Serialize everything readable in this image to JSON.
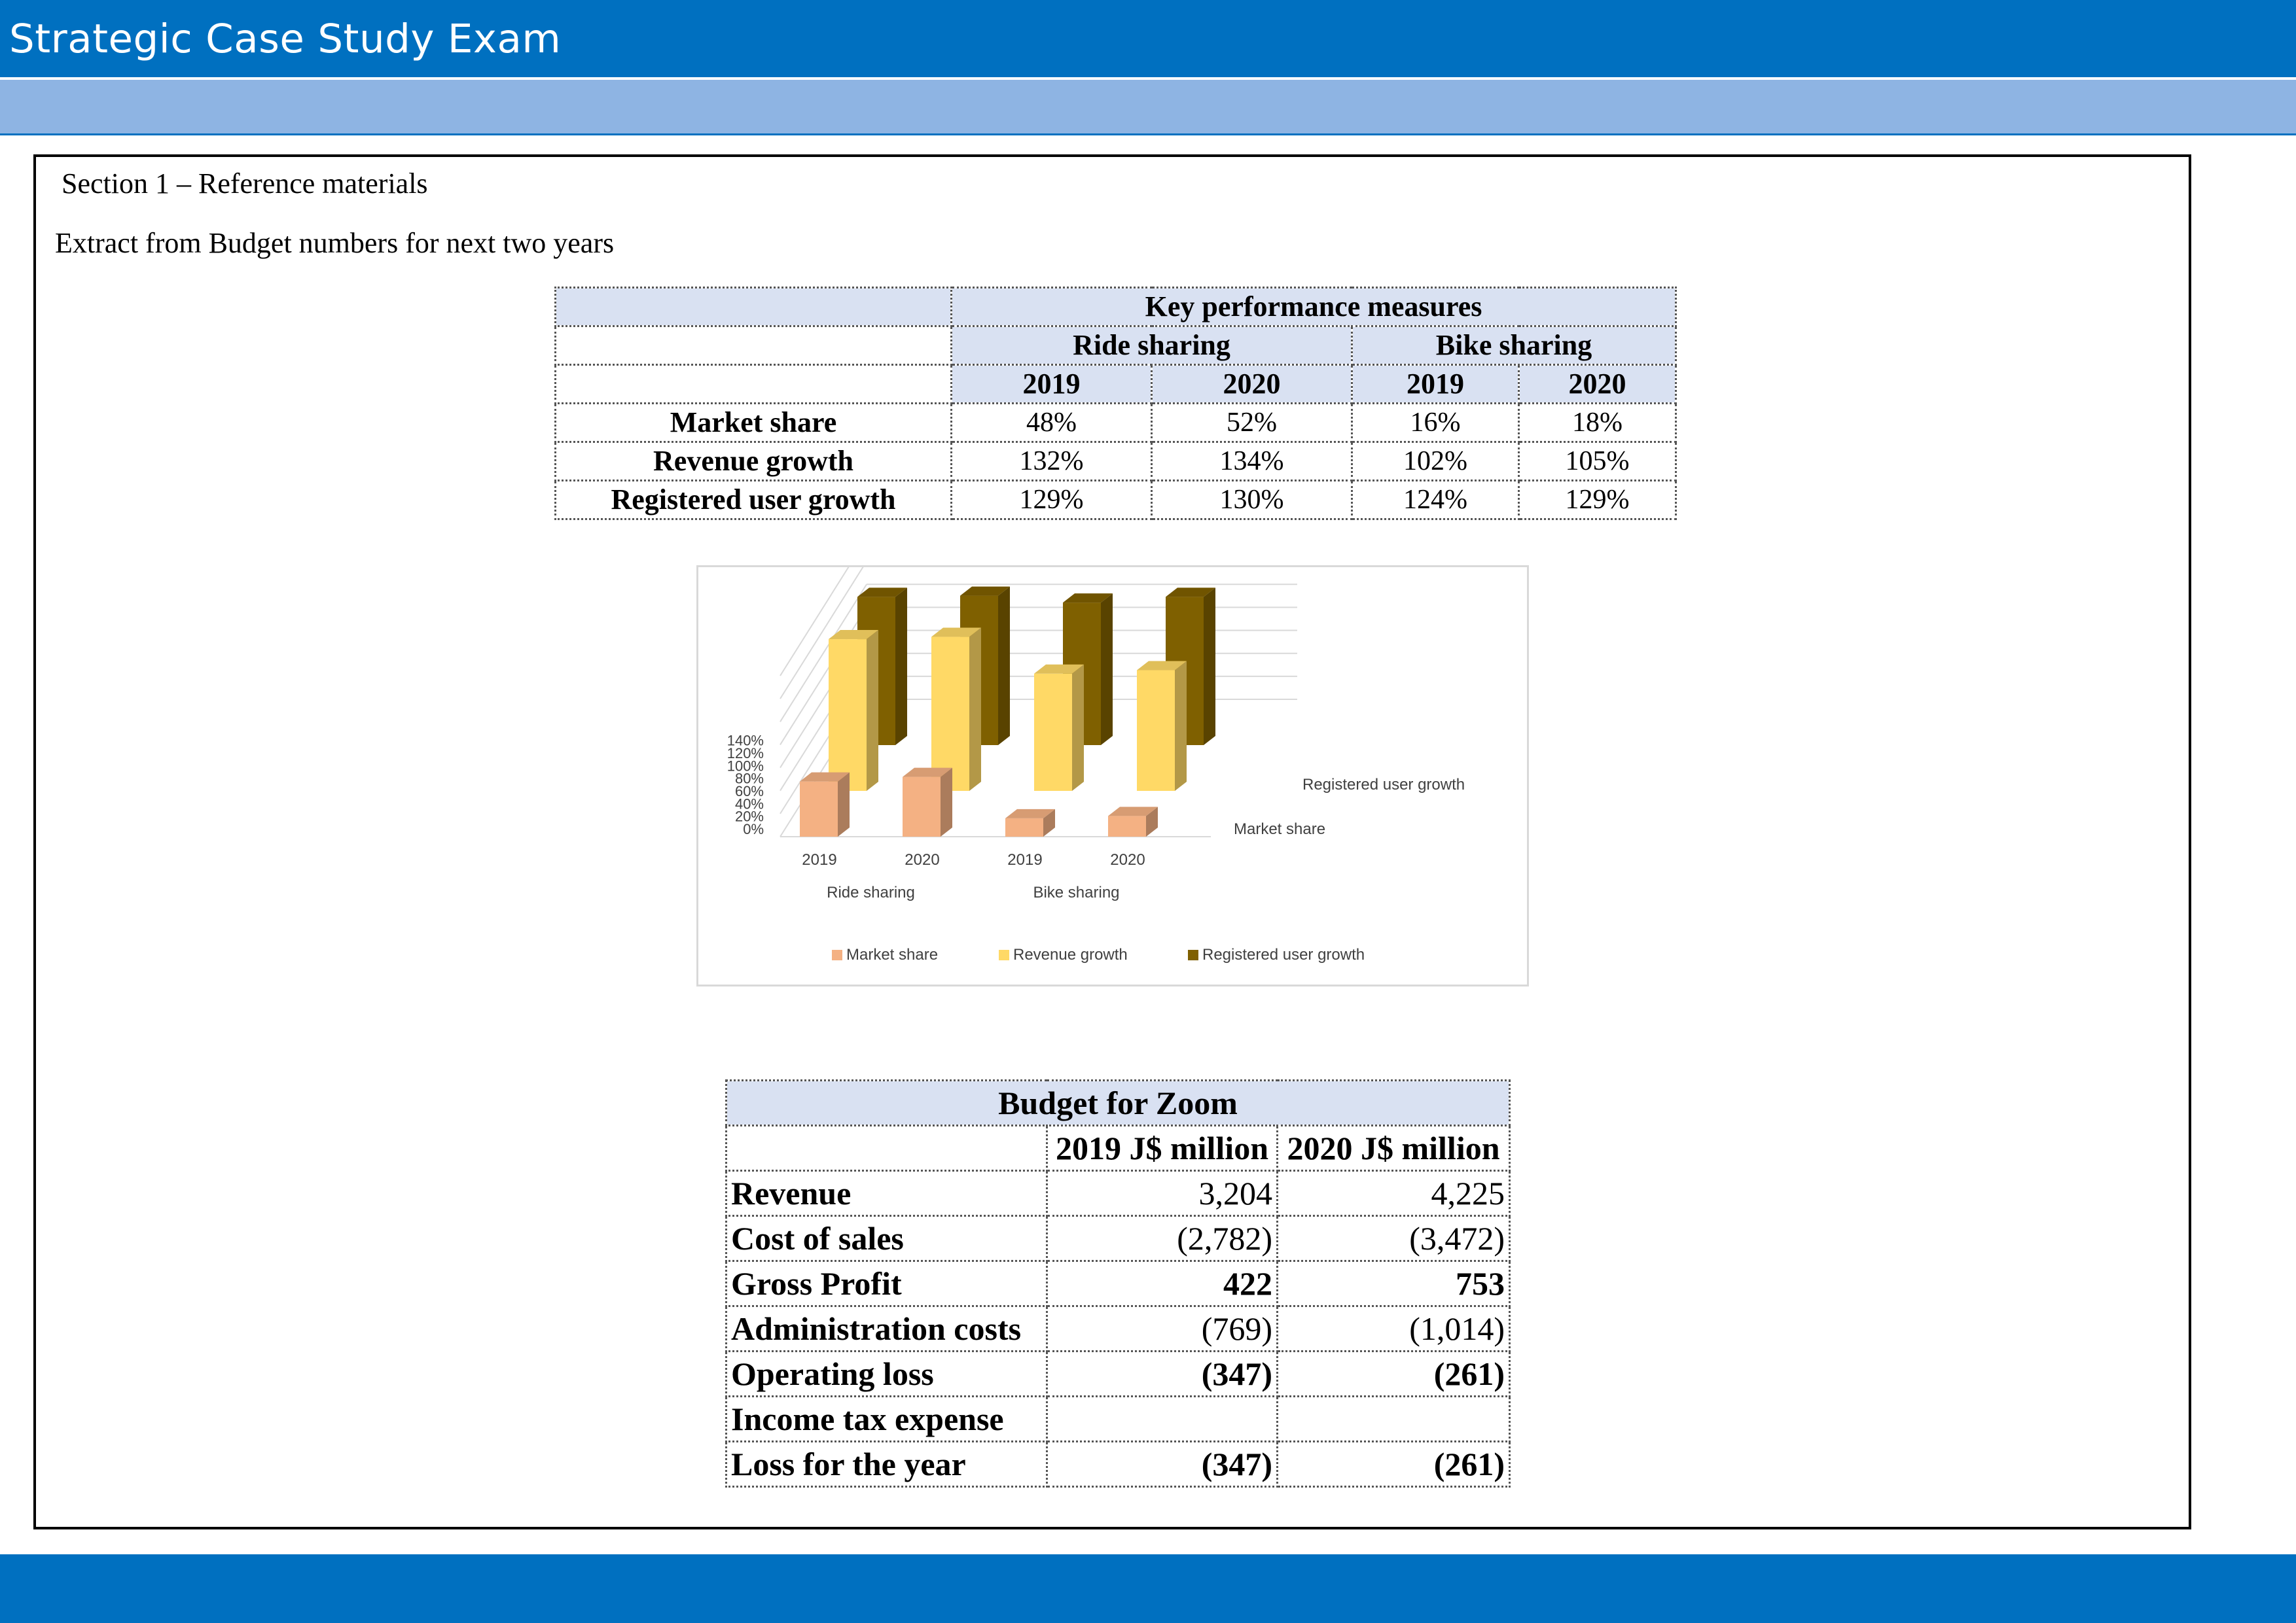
{
  "header": {
    "title": "Strategic Case Study Exam"
  },
  "section": {
    "title": "Section 1 – Reference materials",
    "extract_title": "Extract from Budget numbers for next two years"
  },
  "kpi_table": {
    "title": "Key performance measures",
    "groups": [
      "Ride sharing",
      "Bike sharing"
    ],
    "years": [
      "2019",
      "2020",
      "2019",
      "2020"
    ],
    "rows": [
      {
        "label": "Market share",
        "values": [
          "48%",
          "52%",
          "16%",
          "18%"
        ]
      },
      {
        "label": "Revenue growth",
        "values": [
          "132%",
          "134%",
          "102%",
          "105%"
        ]
      },
      {
        "label": "Registered user growth",
        "values": [
          "129%",
          "130%",
          "124%",
          "129%"
        ]
      }
    ]
  },
  "chart_data": {
    "type": "bar",
    "subtype": "3d-clustered-column",
    "categories": [
      "2019",
      "2020",
      "2019",
      "2020"
    ],
    "category_groups": [
      {
        "label": "Ride sharing",
        "categories": [
          "2019",
          "2020"
        ]
      },
      {
        "label": "Bike sharing",
        "categories": [
          "2019",
          "2020"
        ]
      }
    ],
    "series": [
      {
        "name": "Market share",
        "values": [
          48,
          52,
          16,
          18
        ],
        "color": "#f4b183"
      },
      {
        "name": "Revenue growth",
        "values": [
          132,
          134,
          102,
          105
        ],
        "color": "#ffd966"
      },
      {
        "name": "Registered user growth",
        "values": [
          129,
          130,
          124,
          129
        ],
        "color": "#7f6000"
      }
    ],
    "y_ticks": [
      "0%",
      "20%",
      "40%",
      "60%",
      "80%",
      "100%",
      "120%",
      "140%"
    ],
    "ylim": [
      0,
      140
    ],
    "depth_labels": [
      "Registered user growth",
      "Market share"
    ],
    "legend": [
      "Market share",
      "Revenue growth",
      "Registered user growth"
    ],
    "legend_position": "bottom",
    "grid": true
  },
  "budget_table": {
    "title": "Budget for Zoom",
    "columns": [
      "2019 J$ million",
      "2020 J$ million"
    ],
    "rows": [
      {
        "label": "Revenue",
        "values": [
          "3,204",
          "4,225"
        ],
        "bold": false
      },
      {
        "label": "Cost of sales",
        "values": [
          "(2,782)",
          "(3,472)"
        ],
        "bold": false
      },
      {
        "label": "Gross Profit",
        "values": [
          "422",
          "753"
        ],
        "bold": true
      },
      {
        "label": "Administration costs",
        "values": [
          "(769)",
          "(1,014)"
        ],
        "bold": false
      },
      {
        "label": "Operating loss",
        "values": [
          "(347)",
          "(261)"
        ],
        "bold": true
      },
      {
        "label": "Income tax expense",
        "values": [
          "",
          ""
        ],
        "bold": false
      },
      {
        "label": "Loss for the year",
        "values": [
          "(347)",
          "(261)"
        ],
        "bold": true
      }
    ]
  }
}
